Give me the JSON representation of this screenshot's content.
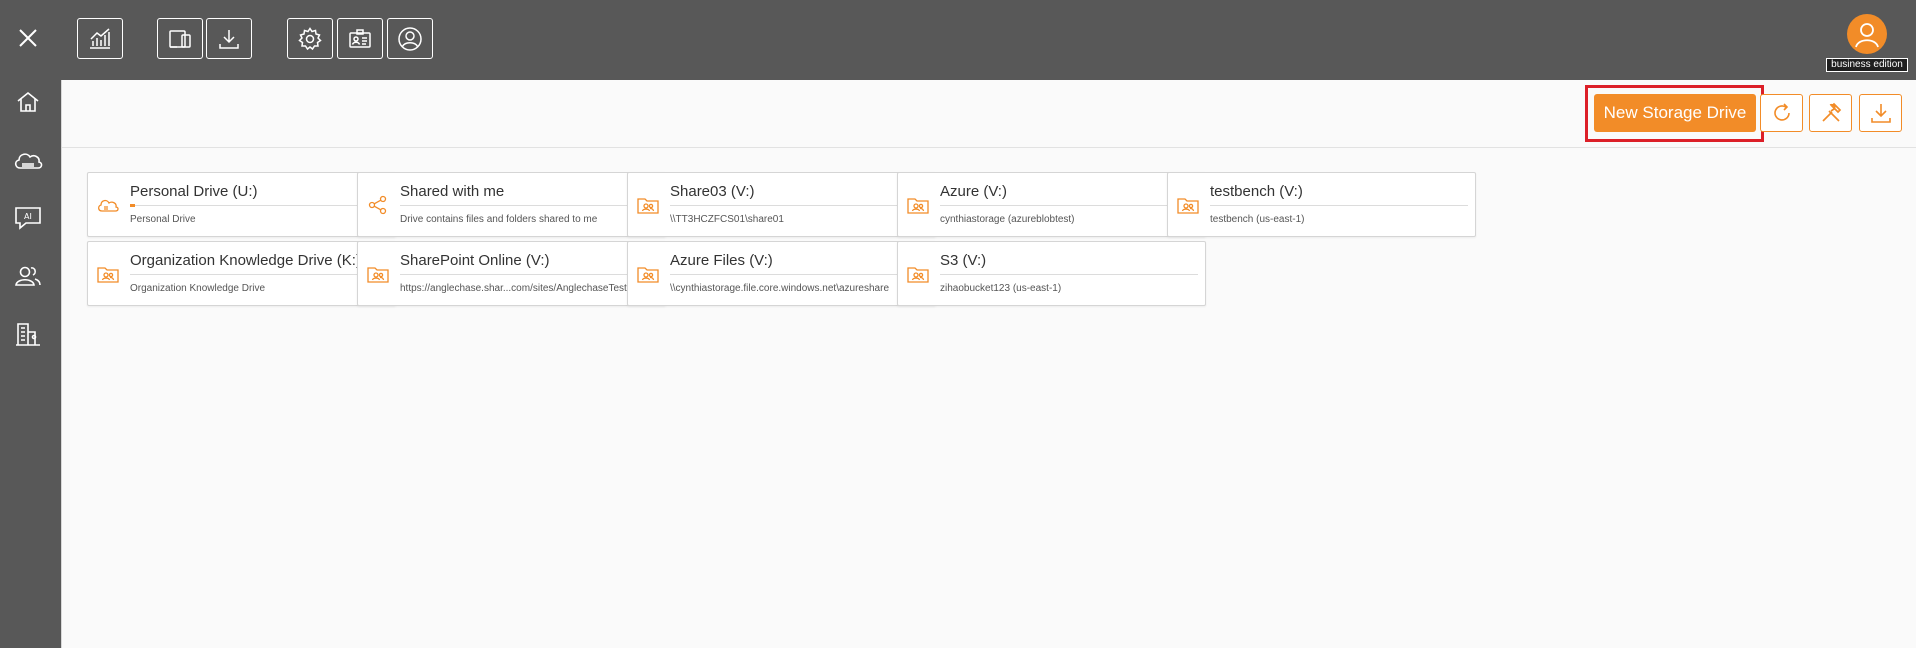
{
  "header": {
    "user": {
      "edition_label": "business edition"
    }
  },
  "toolbar": {
    "new_drive_label": "New Storage Drive"
  },
  "drives": [
    {
      "name": "Personal Drive (U:)",
      "subtitle": "Personal Drive",
      "icon": "cloud-drive-icon",
      "usage": 0.02
    },
    {
      "name": "Shared with me",
      "subtitle": "Drive contains files and folders shared to me",
      "icon": "share-icon"
    },
    {
      "name": "Share03 (V:)",
      "subtitle": "\\\\TT3HCZFCS01\\share01",
      "icon": "shared-folder-icon"
    },
    {
      "name": "Azure (V:)",
      "subtitle": "cynthiastorage (azureblobtest)",
      "icon": "shared-folder-icon"
    },
    {
      "name": "testbench (V:)",
      "subtitle": "testbench (us-east-1)",
      "icon": "shared-folder-icon"
    },
    {
      "name": "Organization Knowledge Drive (K:)",
      "subtitle": "Organization Knowledge Drive",
      "icon": "shared-folder-icon"
    },
    {
      "name": "SharePoint Online (V:)",
      "subtitle": "https://anglechase.shar...com/sites/AnglechaseTest",
      "icon": "shared-folder-icon"
    },
    {
      "name": "Azure Files (V:)",
      "subtitle": "\\\\cynthiastorage.file.core.windows.net\\azureshare",
      "icon": "shared-folder-icon"
    },
    {
      "name": "S3 (V:)",
      "subtitle": "zihaobucket123 (us-east-1)",
      "icon": "shared-folder-icon"
    }
  ],
  "colors": {
    "accent": "#f28c28",
    "chrome": "#585858",
    "highlight": "#dc1f28",
    "content_bg": "#fafafa"
  }
}
